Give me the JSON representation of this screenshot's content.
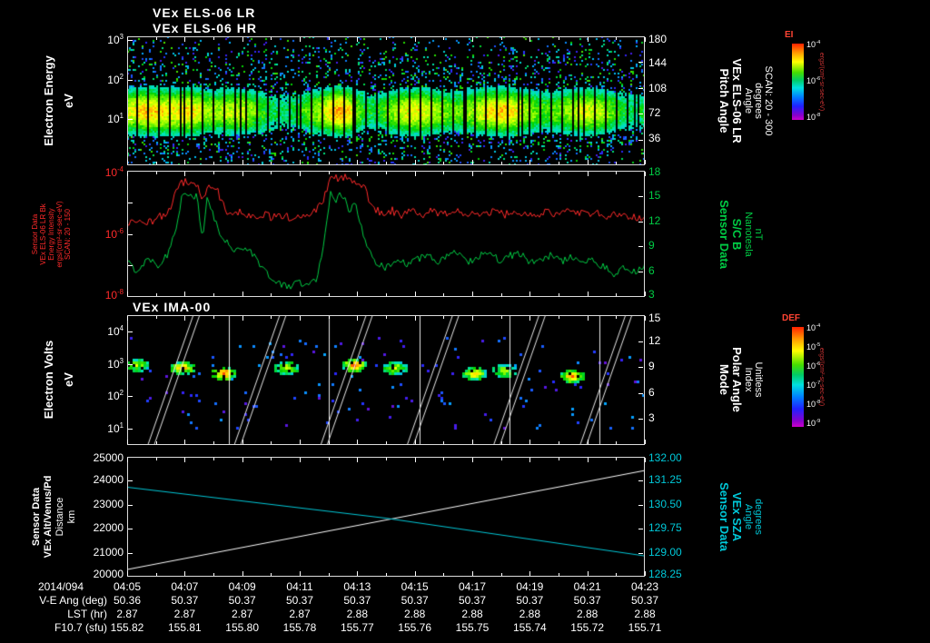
{
  "header": {
    "title_lr": "VEx ELS-06 LR",
    "title_hr": "VEx ELS-06 HR",
    "ima_title": "VEx IMA-00"
  },
  "panel1": {
    "left_label": [
      "Electron Energy",
      "eV"
    ],
    "left_tick_exponents": [
      "3",
      "2",
      "1"
    ],
    "right_ticks": [
      "180",
      "144",
      "108",
      "72",
      "36"
    ],
    "right_label": [
      "Pitch Angle",
      "VEx ELS-06 LR",
      "Angle",
      "degrees",
      "SCAN: 20 - 300"
    ],
    "colorbar": {
      "title": "EI",
      "tick_exponents": [
        "-4",
        "-6",
        "-8"
      ],
      "units": "ergs/(cm²-sr-sec-eV)"
    }
  },
  "panel2": {
    "left_label": [
      "Sensor Data",
      "VEx ELS-06 LR Bk",
      "Energy Intensity",
      "ergs/(cm²-sr-sec-eV)",
      "SCAN: 20 - 150"
    ],
    "left_tick_exponents": [
      "-4",
      "-6",
      "-8"
    ],
    "right_ticks": [
      "18",
      "15",
      "12",
      "9",
      "6",
      "3"
    ],
    "right_label": [
      "Sensor Data",
      "S/C B",
      "Nanotesla",
      "nT"
    ]
  },
  "panel3": {
    "left_label": [
      "Electron Volts",
      "eV"
    ],
    "left_tick_exponents": [
      "4",
      "3",
      "2",
      "1"
    ],
    "right_ticks": [
      "15",
      "12",
      "9",
      "6",
      "3"
    ],
    "right_label": [
      "Mode",
      "Polar Angle",
      "Index",
      "Unitless"
    ],
    "colorbar": {
      "title": "DEF",
      "tick_exponents": [
        "-4",
        "-5",
        "-6",
        "-7",
        "-8",
        "-9"
      ],
      "units": "ergs/(cm²-sr-sec-eV)"
    }
  },
  "panel4": {
    "left_label": [
      "Sensor Data",
      "VEx Alt/Venus/Pd",
      "Distance",
      "km"
    ],
    "left_ticks": [
      "25000",
      "24000",
      "23000",
      "22000",
      "21000",
      "20000"
    ],
    "right_ticks": [
      "132.00",
      "131.25",
      "130.50",
      "129.75",
      "129.00",
      "128.25"
    ],
    "right_label": [
      "Sensor Data",
      "VEx SZA",
      "Angle",
      "degrees"
    ]
  },
  "time_axis": {
    "date": "2014/094",
    "ticks": [
      "04:05",
      "04:07",
      "04:09",
      "04:11",
      "04:13",
      "04:15",
      "04:17",
      "04:19",
      "04:21",
      "04:23"
    ]
  },
  "table_rows": [
    {
      "label": "V-E Ang (deg)",
      "values": [
        "50.36",
        "50.37",
        "50.37",
        "50.37",
        "50.37",
        "50.37",
        "50.37",
        "50.37",
        "50.37",
        "50.37"
      ]
    },
    {
      "label": "LST (hr)",
      "values": [
        "2.87",
        "2.87",
        "2.87",
        "2.87",
        "2.88",
        "2.88",
        "2.88",
        "2.88",
        "2.88",
        "2.88"
      ]
    },
    {
      "label": "F10.7 (sfu)",
      "values": [
        "155.82",
        "155.81",
        "155.80",
        "155.78",
        "155.77",
        "155.76",
        "155.75",
        "155.74",
        "155.72",
        "155.71"
      ]
    }
  ],
  "colors": {
    "red": "#ff2a2a",
    "green": "#00cc44",
    "cyan": "#00c8d8",
    "white": "#ffffff",
    "colorbar_title": "#ff4433"
  },
  "chart_data": [
    {
      "id": "els_spectrogram",
      "type": "heatmap",
      "title": "VEx ELS-06 LR / VEx ELS-06 HR",
      "ylabel": "Electron Energy (eV)",
      "y_scale": "log",
      "y_ticks": [
        1000,
        100,
        10
      ],
      "right_axis": {
        "label": "Pitch Angle VEx ELS-06 LR (degrees) SCAN: 20 - 300",
        "ticks": [
          180,
          144,
          108,
          72,
          36
        ]
      },
      "x_range": [
        "04:05",
        "04:23"
      ],
      "colorbar": {
        "label": "EI",
        "units": "ergs/(cm²-sr-sec-eV)",
        "tick_exponents": [
          -4,
          -6,
          -8
        ]
      },
      "appearance": {
        "hotspots_time_frac": [
          0.12,
          0.415
        ]
      },
      "summary": "Continuous bright green-yellow electron band between ~6 and ~60 eV for the whole interval, red enhancements near 04:07 and 04:12, sparse cyan/blue speckle at other energies, regular narrow vertical data gaps."
    },
    {
      "id": "intensity_and_bfield",
      "type": "line",
      "series": [
        {
          "name": "VEx ELS-06 LR Bk Energy Intensity",
          "units": "ergs/(cm²-sr-sec-eV)",
          "axis": "left",
          "scale": "log",
          "range_exp": [
            -8,
            -4
          ],
          "color": "#ff2a2a",
          "points": [
            [
              0,
              -5.75
            ],
            [
              0.02,
              -5.55
            ],
            [
              0.04,
              -5.65
            ],
            [
              0.06,
              -5.5
            ],
            [
              0.08,
              -5.25
            ],
            [
              0.095,
              -4.7
            ],
            [
              0.105,
              -4.4
            ],
            [
              0.115,
              -4.3
            ],
            [
              0.125,
              -4.38
            ],
            [
              0.135,
              -4.45
            ],
            [
              0.145,
              -5
            ],
            [
              0.155,
              -4.55
            ],
            [
              0.165,
              -4.5
            ],
            [
              0.175,
              -4.62
            ],
            [
              0.185,
              -5.1
            ],
            [
              0.2,
              -5.4
            ],
            [
              0.22,
              -5.3
            ],
            [
              0.24,
              -5.45
            ],
            [
              0.26,
              -5.35
            ],
            [
              0.28,
              -5.5
            ],
            [
              0.3,
              -5.4
            ],
            [
              0.32,
              -5.55
            ],
            [
              0.34,
              -5.4
            ],
            [
              0.36,
              -5.3
            ],
            [
              0.375,
              -5.1
            ],
            [
              0.39,
              -4.35
            ],
            [
              0.4,
              -4.18
            ],
            [
              0.41,
              -4.3
            ],
            [
              0.42,
              -4.22
            ],
            [
              0.432,
              -4.28
            ],
            [
              0.445,
              -4.5
            ],
            [
              0.458,
              -4.42
            ],
            [
              0.47,
              -5.05
            ],
            [
              0.49,
              -5.35
            ],
            [
              0.51,
              -5.25
            ],
            [
              0.53,
              -5.4
            ],
            [
              0.55,
              -5.3
            ],
            [
              0.57,
              -5.42
            ],
            [
              0.59,
              -5.28
            ],
            [
              0.61,
              -5.38
            ],
            [
              0.63,
              -5.25
            ],
            [
              0.65,
              -5.4
            ],
            [
              0.67,
              -5.3
            ],
            [
              0.69,
              -5.35
            ],
            [
              0.71,
              -5.25
            ],
            [
              0.73,
              -5.4
            ],
            [
              0.75,
              -5.28
            ],
            [
              0.77,
              -5.38
            ],
            [
              0.79,
              -5.45
            ],
            [
              0.81,
              -5.3
            ],
            [
              0.83,
              -5.4
            ],
            [
              0.85,
              -5.32
            ],
            [
              0.87,
              -5.28
            ],
            [
              0.89,
              -5.4
            ],
            [
              0.91,
              -5.34
            ],
            [
              0.93,
              -5.45
            ],
            [
              0.95,
              -5.38
            ],
            [
              0.97,
              -5.5
            ],
            [
              1,
              -5.45
            ]
          ]
        },
        {
          "name": "S/C B",
          "units": "nT",
          "axis": "right",
          "scale": "linear",
          "range": [
            3,
            18
          ],
          "color": "#00cc44",
          "points": [
            [
              0,
              7.2
            ],
            [
              0.02,
              6
            ],
            [
              0.04,
              7.8
            ],
            [
              0.06,
              6.8
            ],
            [
              0.08,
              8.2
            ],
            [
              0.095,
              11.5
            ],
            [
              0.105,
              14.8
            ],
            [
              0.115,
              15.6
            ],
            [
              0.125,
              14.6
            ],
            [
              0.135,
              15.2
            ],
            [
              0.145,
              9.5
            ],
            [
              0.155,
              14.8
            ],
            [
              0.165,
              13
            ],
            [
              0.175,
              11
            ],
            [
              0.19,
              9.5
            ],
            [
              0.21,
              8.6
            ],
            [
              0.23,
              9
            ],
            [
              0.25,
              7.5
            ],
            [
              0.27,
              5.8
            ],
            [
              0.29,
              4.6
            ],
            [
              0.31,
              4.2
            ],
            [
              0.33,
              4.8
            ],
            [
              0.35,
              4.3
            ],
            [
              0.365,
              5.2
            ],
            [
              0.38,
              9
            ],
            [
              0.393,
              15.8
            ],
            [
              0.403,
              14.6
            ],
            [
              0.415,
              15.4
            ],
            [
              0.428,
              13.2
            ],
            [
              0.44,
              14
            ],
            [
              0.452,
              11.5
            ],
            [
              0.465,
              8.5
            ],
            [
              0.48,
              7
            ],
            [
              0.5,
              6.4
            ],
            [
              0.52,
              7.6
            ],
            [
              0.54,
              6.8
            ],
            [
              0.56,
              7.4
            ],
            [
              0.58,
              8.2
            ],
            [
              0.6,
              7
            ],
            [
              0.62,
              7.8
            ],
            [
              0.64,
              8.4
            ],
            [
              0.66,
              7.2
            ],
            [
              0.68,
              7.9
            ],
            [
              0.7,
              8.6
            ],
            [
              0.72,
              7.3
            ],
            [
              0.74,
              7.9
            ],
            [
              0.76,
              8.1
            ],
            [
              0.78,
              7
            ],
            [
              0.8,
              7.6
            ],
            [
              0.82,
              8
            ],
            [
              0.84,
              7.2
            ],
            [
              0.86,
              7.8
            ],
            [
              0.88,
              6.9
            ],
            [
              0.9,
              7.4
            ],
            [
              0.92,
              6.6
            ],
            [
              0.94,
              5.6
            ],
            [
              0.96,
              6.4
            ],
            [
              0.98,
              6
            ],
            [
              1,
              6.8
            ]
          ]
        }
      ]
    },
    {
      "id": "ima_spectrogram",
      "type": "heatmap",
      "title": "VEx IMA-00",
      "ylabel": "Electron Volts (eV)",
      "y_scale": "log",
      "y_ticks": [
        10000,
        1000,
        100,
        10
      ],
      "right_axis": {
        "label": "Mode / Polar Angle Index (Unitless)",
        "ticks": [
          15,
          12,
          9,
          6,
          3
        ]
      },
      "colorbar": {
        "label": "DEF",
        "units": "ergs/(cm²-sr-sec-eV)",
        "tick_exponents": [
          -4,
          -5,
          -6,
          -7,
          -8,
          -9
        ]
      },
      "segment_boundaries_frac": [
        0.196,
        0.389,
        0.565,
        0.738,
        0.912
      ],
      "sweep_starts_frac": [
        0.04,
        0.207,
        0.374,
        0.541,
        0.708,
        0.875
      ],
      "clusters": [
        {
          "x": 0.014,
          "s": 0.55
        },
        {
          "x": 0.105,
          "s": 0.8
        },
        {
          "x": 0.184,
          "s": 0.95
        },
        {
          "x": 0.307,
          "s": 0.65
        },
        {
          "x": 0.439,
          "s": 0.9
        },
        {
          "x": 0.518,
          "s": 0.6
        },
        {
          "x": 0.667,
          "s": 0.75
        },
        {
          "x": 0.728,
          "s": 0.55
        },
        {
          "x": 0.86,
          "s": 0.85
        }
      ],
      "summary": "Ion energy flux clusters near 10^2–10^3 eV in repeating groups, white diagonal energy-sweep lines and vertical segment boundaries, sparse blue pixels elsewhere."
    },
    {
      "id": "altitude_and_sza",
      "type": "line",
      "series": [
        {
          "name": "VEx Alt/Venus/Pd Distance",
          "units": "km",
          "axis": "left",
          "range": [
            20000,
            25000
          ],
          "color": "#ffffff",
          "points": [
            [
              0,
              20300
            ],
            [
              1,
              24430
            ]
          ]
        },
        {
          "name": "VEx SZA Angle",
          "units": "degrees",
          "axis": "right",
          "range": [
            128.25,
            132.0
          ],
          "color": "#00c8d8",
          "points": [
            [
              0,
              131.05
            ],
            [
              0.5,
              130.08
            ],
            [
              1,
              128.9
            ]
          ]
        }
      ]
    }
  ]
}
